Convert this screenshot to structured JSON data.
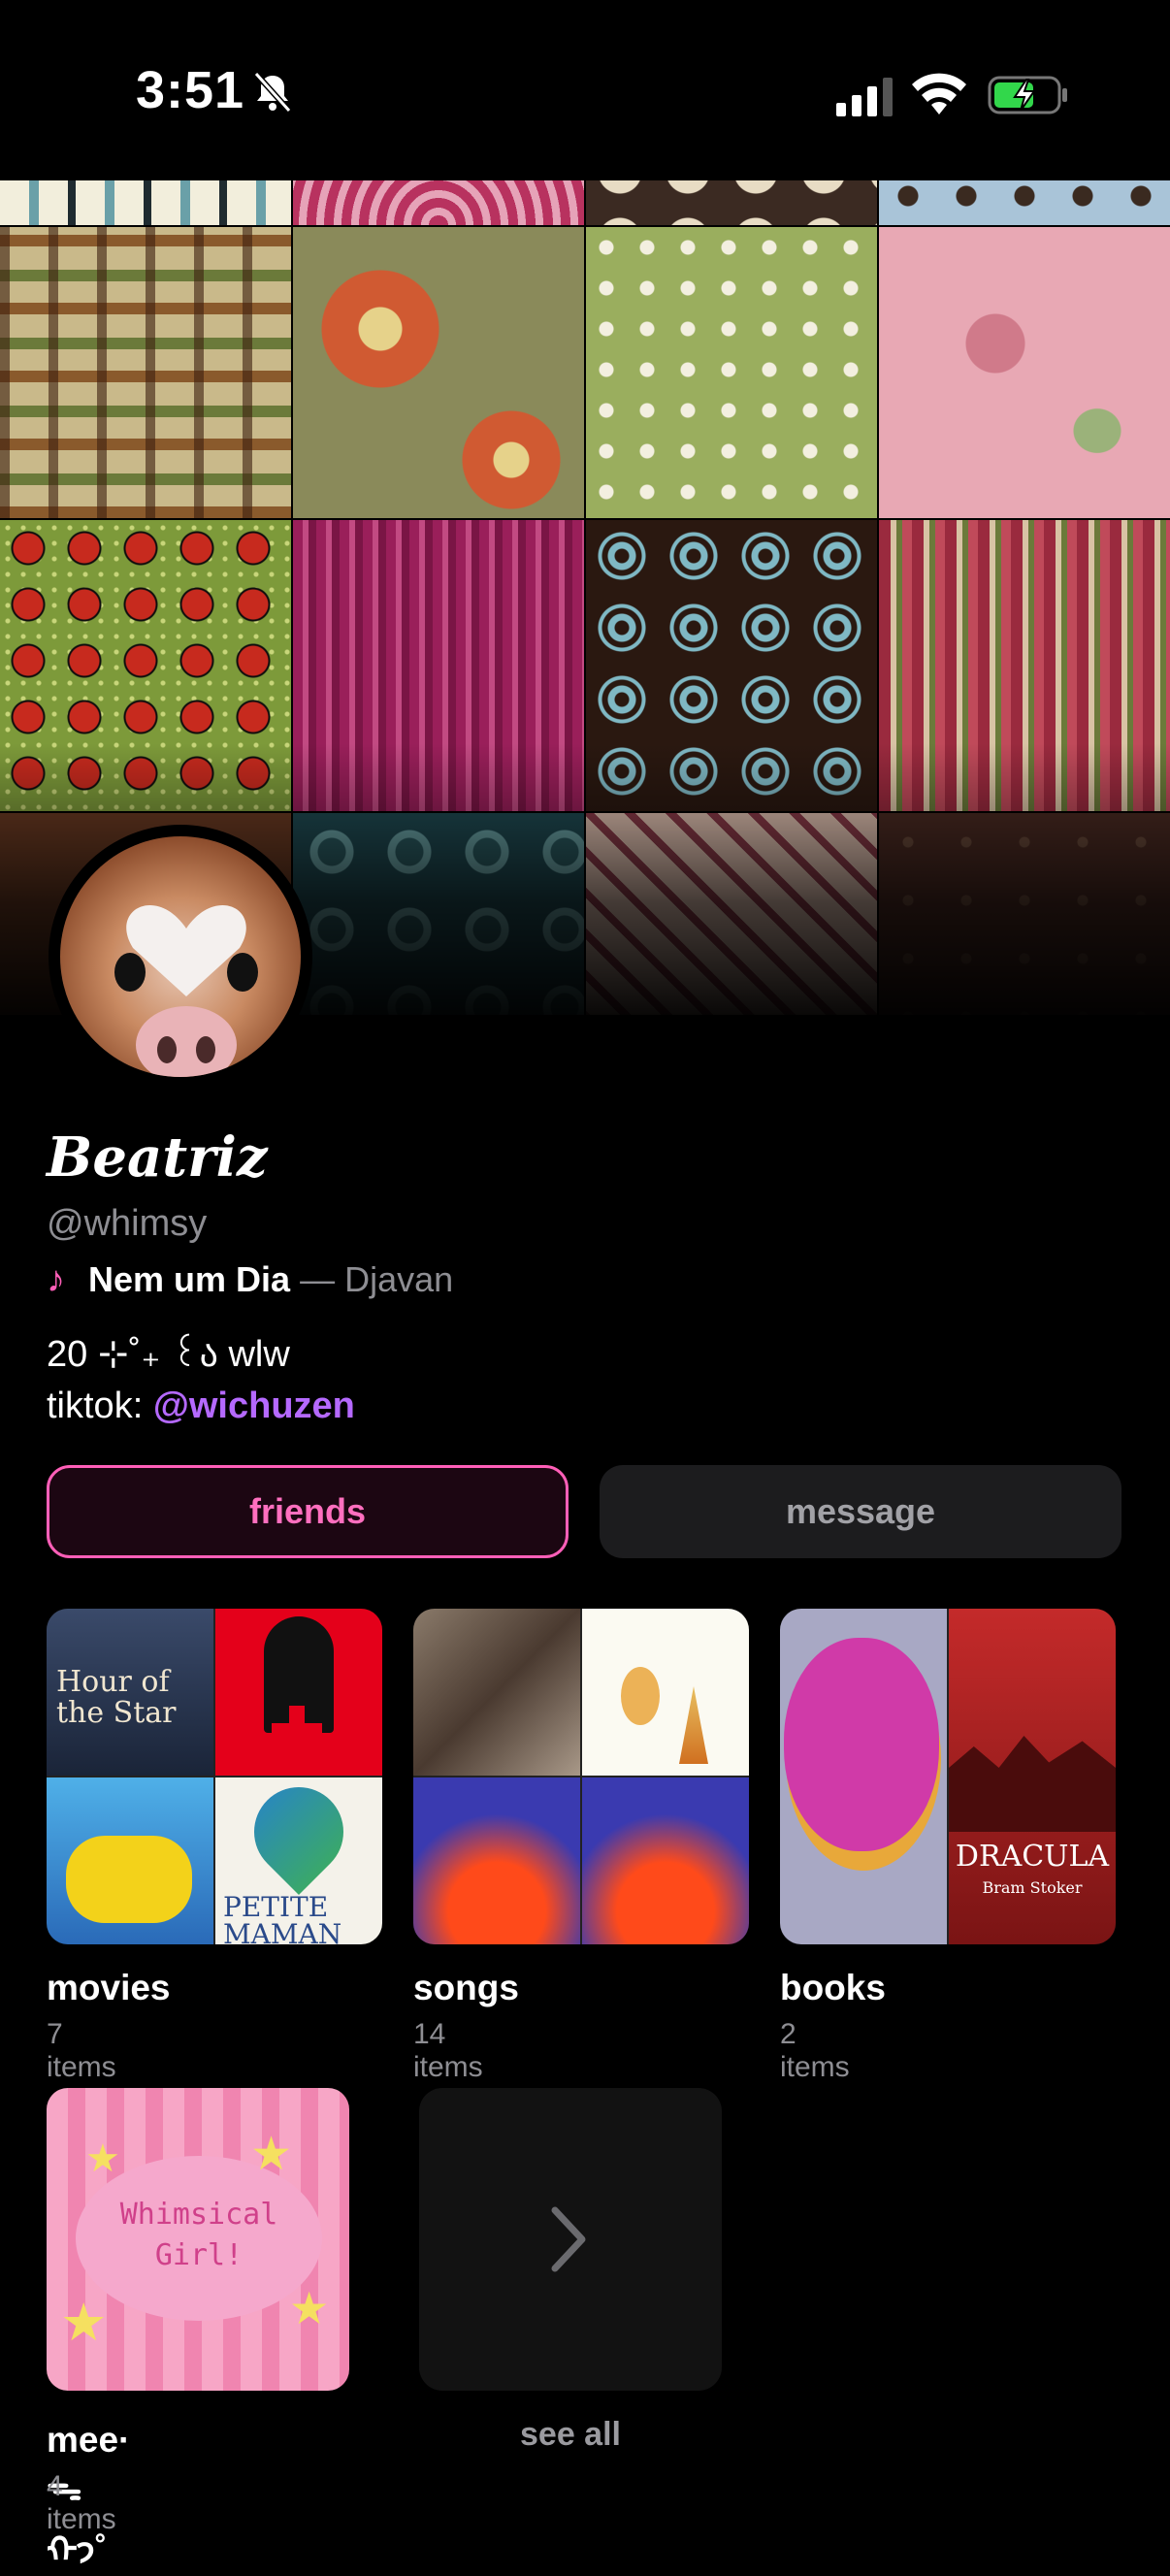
{
  "status_bar": {
    "time": "3:51",
    "icons": [
      "bell-slash-icon",
      "cellular-signal-icon",
      "wifi-icon",
      "battery-charging-icon"
    ]
  },
  "profile": {
    "display_name": "Beatriz",
    "handle": "@whimsy",
    "now_playing": {
      "icon": "music-note-icon",
      "title": "Nem um Dia",
      "separator": " — ",
      "artist": "Djavan"
    },
    "bio_line": "20 ⊹˚₊ ꒰ა wlw",
    "tiktok_prefix": "tiktok: ",
    "tiktok_handle": "@wichuzen"
  },
  "buttons": {
    "friends": "friends",
    "message": "message"
  },
  "collections": [
    {
      "title": "movies",
      "count": "7 items"
    },
    {
      "title": "songs",
      "count": "14 items"
    },
    {
      "title": "books",
      "count": "2 items"
    },
    {
      "title": "mee·ᯓᡣ𐭩˚",
      "count": "4 items"
    }
  ],
  "cover_text": {
    "movie_poster": "Hour of the Star",
    "movie_poster_2": "PETITE MAMAN",
    "book_dracula": "DRACULA",
    "book_author": "Bram Stoker",
    "whimsical": "Whimsical Girl!"
  },
  "see_all": {
    "label": "see all",
    "icon": "chevron-right-icon"
  },
  "colors": {
    "accent_pink": "#ff5fb8",
    "link_purple": "#b569ff",
    "muted": "#8e8e93"
  }
}
